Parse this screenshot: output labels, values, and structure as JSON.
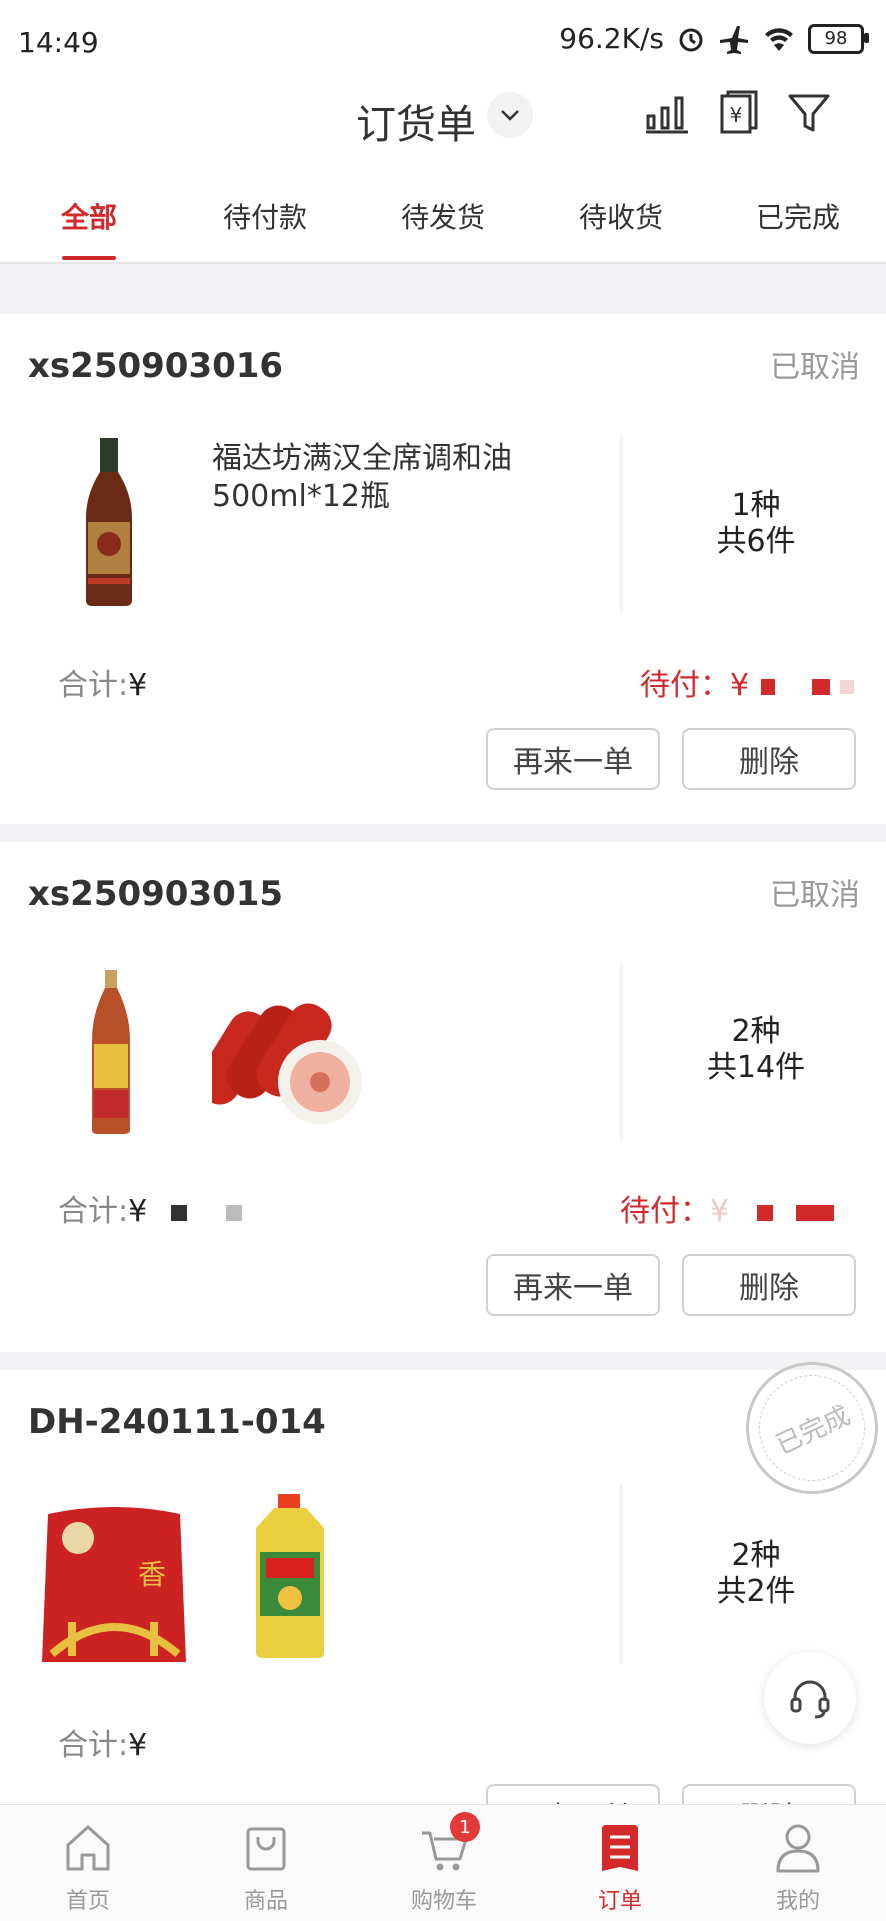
{
  "status_bar": {
    "time": "14:49",
    "speed": "96.2K/s",
    "battery": "98"
  },
  "header": {
    "title": "订货单"
  },
  "tabs": [
    {
      "label": "全部",
      "active": true
    },
    {
      "label": "待付款"
    },
    {
      "label": "待发货"
    },
    {
      "label": "待收货"
    },
    {
      "label": "已完成"
    }
  ],
  "orders": [
    {
      "order_no": "xs250903016",
      "status": "已取消",
      "product_name": "福达坊满汉全席调和油500ml*12瓶",
      "kinds": "1种",
      "pieces": "共6件",
      "total_label": "合计:",
      "total_yen": "¥",
      "due_label": "待付：",
      "due_yen": "¥",
      "buttons": {
        "reorder": "再来一单",
        "delete": "删除"
      }
    },
    {
      "order_no": "xs250903015",
      "status": "已取消",
      "kinds": "2种",
      "pieces": "共14件",
      "total_label": "合计:",
      "total_yen": "¥",
      "due_label": "待付：",
      "due_yen": "¥",
      "buttons": {
        "reorder": "再来一单",
        "delete": "删除"
      }
    },
    {
      "order_no": "DH-240111-014",
      "status": "已完成",
      "kinds": "2种",
      "pieces": "共2件",
      "total_label": "合计:",
      "total_yen": "¥",
      "buttons": {
        "reorder": "再来一单",
        "delete": "删除"
      }
    }
  ],
  "bottom_nav": [
    {
      "label": "首页",
      "icon": "home-icon"
    },
    {
      "label": "商品",
      "icon": "bag-icon"
    },
    {
      "label": "购物车",
      "icon": "cart-icon",
      "badge": "1"
    },
    {
      "label": "订单",
      "icon": "order-icon",
      "active": true
    },
    {
      "label": "我的",
      "icon": "user-icon"
    }
  ],
  "colors": {
    "accent": "#d22a2a",
    "gray_text": "#999999",
    "background_gap": "#f2f2f4"
  }
}
